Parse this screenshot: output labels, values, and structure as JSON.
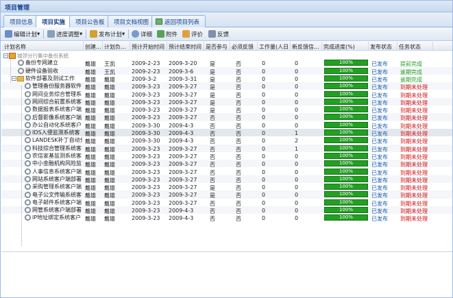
{
  "window": {
    "title": "项目管理"
  },
  "tabs": [
    {
      "label": "项目信息",
      "active": false
    },
    {
      "label": "项目实施",
      "active": true
    },
    {
      "label": "项目公告板",
      "active": false
    },
    {
      "label": "项目文档视图",
      "active": false
    },
    {
      "label": "返回项目列表",
      "active": false
    }
  ],
  "toolbar": {
    "edit_plan": "编辑计划",
    "progress_adjust": "进度调整",
    "publish_plan": "发布计划",
    "detail": "详细",
    "attachment": "附件",
    "review": "评价",
    "feedback": "反馈"
  },
  "columns": [
    "计划名称",
    "创建...",
    "计划负...",
    "预计开始时间",
    "预计结束时间",
    "是否参与",
    "必须反馈",
    "工作量(人日",
    "新反馈信...",
    "完成进度(%)",
    "发布状态",
    "任务状态"
  ],
  "root": {
    "label": "城郊分行集中备份系统"
  },
  "rows": [
    {
      "name": "备份专网建立",
      "creator": "戴雄",
      "owner": "王凯",
      "start": "2009-2-23",
      "end": "2009-3-20",
      "participate": "是",
      "feedback": "否",
      "workload": "0",
      "new_fb": "0",
      "progress": "100%",
      "publish": "已发布",
      "status": "提前完成",
      "level": 1,
      "kind": "gear"
    },
    {
      "name": "硬件设备验收",
      "creator": "戴雄",
      "owner": "王凯",
      "start": "2009-2-23",
      "end": "2009-3-6",
      "participate": "是",
      "feedback": "否",
      "workload": "0",
      "new_fb": "0",
      "progress": "100%",
      "publish": "已发布",
      "status": "逾期完成",
      "level": 1,
      "kind": "gear"
    },
    {
      "name": "软件部署及测试工作",
      "creator": "戴雄",
      "owner": "戴雄",
      "start": "2009-3-2",
      "end": "2009-3-31",
      "participate": "是",
      "feedback": "否",
      "workload": "0",
      "new_fb": "0",
      "progress": "100%",
      "publish": "已发布",
      "status": "逾期完成",
      "level": 1,
      "kind": "folder"
    },
    {
      "name": "管理备份服务器软件",
      "creator": "戴雄",
      "owner": "戴雄",
      "start": "2009-3-23",
      "end": "2009-3-27",
      "participate": "是",
      "feedback": "否",
      "workload": "0",
      "new_fb": "0",
      "progress": "100%",
      "publish": "已发布",
      "status": "到期未处理",
      "level": 2,
      "kind": "gear"
    },
    {
      "name": "网间业务综合管理系",
      "creator": "戴雄",
      "owner": "戴雄",
      "start": "2009-3-23",
      "end": "2009-3-27",
      "participate": "是",
      "feedback": "否",
      "workload": "0",
      "new_fb": "0",
      "progress": "100%",
      "publish": "已发布",
      "status": "到期未处理",
      "level": 2,
      "kind": "gear"
    },
    {
      "name": "网间综合前置系统客",
      "creator": "戴雄",
      "owner": "戴雄",
      "start": "2009-3-23",
      "end": "2009-3-27",
      "participate": "是",
      "feedback": "否",
      "workload": "0",
      "new_fb": "0",
      "progress": "100%",
      "publish": "已发布",
      "status": "到期未处理",
      "level": 2,
      "kind": "gear"
    },
    {
      "name": "数据报表系统客户端",
      "creator": "戴雄",
      "owner": "戴雄",
      "start": "2009-3-23",
      "end": "2009-3-27",
      "participate": "是",
      "feedback": "否",
      "workload": "0",
      "new_fb": "0",
      "progress": "100%",
      "publish": "已发布",
      "status": "到期未处理",
      "level": 2,
      "kind": "gear"
    },
    {
      "name": "后督影像系统客户端",
      "creator": "戴雄",
      "owner": "戴雄",
      "start": "2009-3-23",
      "end": "2009-3-27",
      "participate": "否",
      "feedback": "否",
      "workload": "0",
      "new_fb": "0",
      "progress": "100%",
      "publish": "已发布",
      "status": "到期未处理",
      "level": 2,
      "kind": "gear"
    },
    {
      "name": "办公自动化系统客户",
      "creator": "戴雄",
      "owner": "戴雄",
      "start": "2009-3-30",
      "end": "2009-4-3",
      "participate": "否",
      "feedback": "否",
      "workload": "0",
      "new_fb": "0",
      "progress": "100%",
      "publish": "已发布",
      "status": "到期未处理",
      "level": 2,
      "kind": "gear"
    },
    {
      "name": "IDS入侵监测系统客",
      "creator": "戴雄",
      "owner": "戴雄",
      "start": "2009-3-30",
      "end": "2009-4-3",
      "participate": "否",
      "feedback": "否",
      "workload": "0",
      "new_fb": "1",
      "progress": "100%",
      "publish": "已发布",
      "status": "到期未处理",
      "level": 2,
      "kind": "gear"
    },
    {
      "name": "LANDESK补丁自动分",
      "creator": "戴雄",
      "owner": "戴雄",
      "start": "2009-3-30",
      "end": "2009-4-3",
      "participate": "否",
      "feedback": "否",
      "workload": "0",
      "new_fb": "2",
      "progress": "100%",
      "publish": "已发布",
      "status": "到期未处理",
      "level": 2,
      "kind": "gear"
    },
    {
      "name": "科技综合管理系统客",
      "creator": "戴雄",
      "owner": "戴雄",
      "start": "2009-3-23",
      "end": "2009-3-27",
      "participate": "否",
      "feedback": "否",
      "workload": "0",
      "new_fb": "1",
      "progress": "100%",
      "publish": "已发布",
      "status": "到期未处理",
      "level": 2,
      "kind": "gear"
    },
    {
      "name": "农信家基监测系统客",
      "creator": "戴雄",
      "owner": "戴雄",
      "start": "2009-3-23",
      "end": "2009-3-27",
      "participate": "否",
      "feedback": "否",
      "workload": "0",
      "new_fb": "0",
      "progress": "100%",
      "publish": "已发布",
      "status": "到期未处理",
      "level": 2,
      "kind": "gear"
    },
    {
      "name": "中小金融机构风险监",
      "creator": "戴雄",
      "owner": "戴雄",
      "start": "2009-3-23",
      "end": "2009-3-27",
      "participate": "否",
      "feedback": "否",
      "workload": "0",
      "new_fb": "0",
      "progress": "100%",
      "publish": "已发布",
      "status": "到期未处理",
      "level": 2,
      "kind": "gear"
    },
    {
      "name": "人事信息系统客户端",
      "creator": "戴雄",
      "owner": "戴雄",
      "start": "2009-3-23",
      "end": "2009-3-27",
      "participate": "否",
      "feedback": "否",
      "workload": "0",
      "new_fb": "0",
      "progress": "100%",
      "publish": "已发布",
      "status": "到期未处理",
      "level": 2,
      "kind": "gear"
    },
    {
      "name": "网站系统客户端部署",
      "creator": "戴雄",
      "owner": "戴雄",
      "start": "2009-3-23",
      "end": "2009-3-27",
      "participate": "否",
      "feedback": "否",
      "workload": "0",
      "new_fb": "0",
      "progress": "100%",
      "publish": "已发布",
      "status": "到期未处理",
      "level": 2,
      "kind": "gear"
    },
    {
      "name": "采购管理系统客户端",
      "creator": "戴雄",
      "owner": "戴雄",
      "start": "2009-3-23",
      "end": "2009-3-27",
      "participate": "是",
      "feedback": "否",
      "workload": "0",
      "new_fb": "0",
      "progress": "100%",
      "publish": "已发布",
      "status": "到期未处理",
      "level": 2,
      "kind": "gear"
    },
    {
      "name": "电子公文传输系统客",
      "creator": "戴雄",
      "owner": "戴雄",
      "start": "2009-3-23",
      "end": "2009-3-27",
      "participate": "是",
      "feedback": "否",
      "workload": "0",
      "new_fb": "0",
      "progress": "100%",
      "publish": "已发布",
      "status": "到期未处理",
      "level": 2,
      "kind": "gear"
    },
    {
      "name": "电子邮件系统客户端",
      "creator": "戴雄",
      "owner": "戴雄",
      "start": "2009-3-23",
      "end": "2009-3-27",
      "participate": "否",
      "feedback": "否",
      "workload": "0",
      "new_fb": "0",
      "progress": "100%",
      "publish": "已发布",
      "status": "到期未处理",
      "level": 2,
      "kind": "gear"
    },
    {
      "name": "网管系统客户端部署",
      "creator": "戴雄",
      "owner": "戴雄",
      "start": "2009-3-23",
      "end": "2009-4-3",
      "participate": "否",
      "feedback": "否",
      "workload": "0",
      "new_fb": "0",
      "progress": "100%",
      "publish": "已发布",
      "status": "到期未处理",
      "level": 2,
      "kind": "gear"
    },
    {
      "name": "IP地址绑定系统客户",
      "creator": "戴雄",
      "owner": "戴雄",
      "start": "2009-3-23",
      "end": "2009-4-3",
      "participate": "否",
      "feedback": "否",
      "workload": "0",
      "new_fb": "0",
      "progress": "100%",
      "publish": "已发布",
      "status": "到期未处理",
      "level": 2,
      "kind": "gear"
    }
  ],
  "colors": {
    "progress": "#22a022",
    "publish": "#1a5fb4",
    "done": "#22a022",
    "todo": "#d01010"
  }
}
